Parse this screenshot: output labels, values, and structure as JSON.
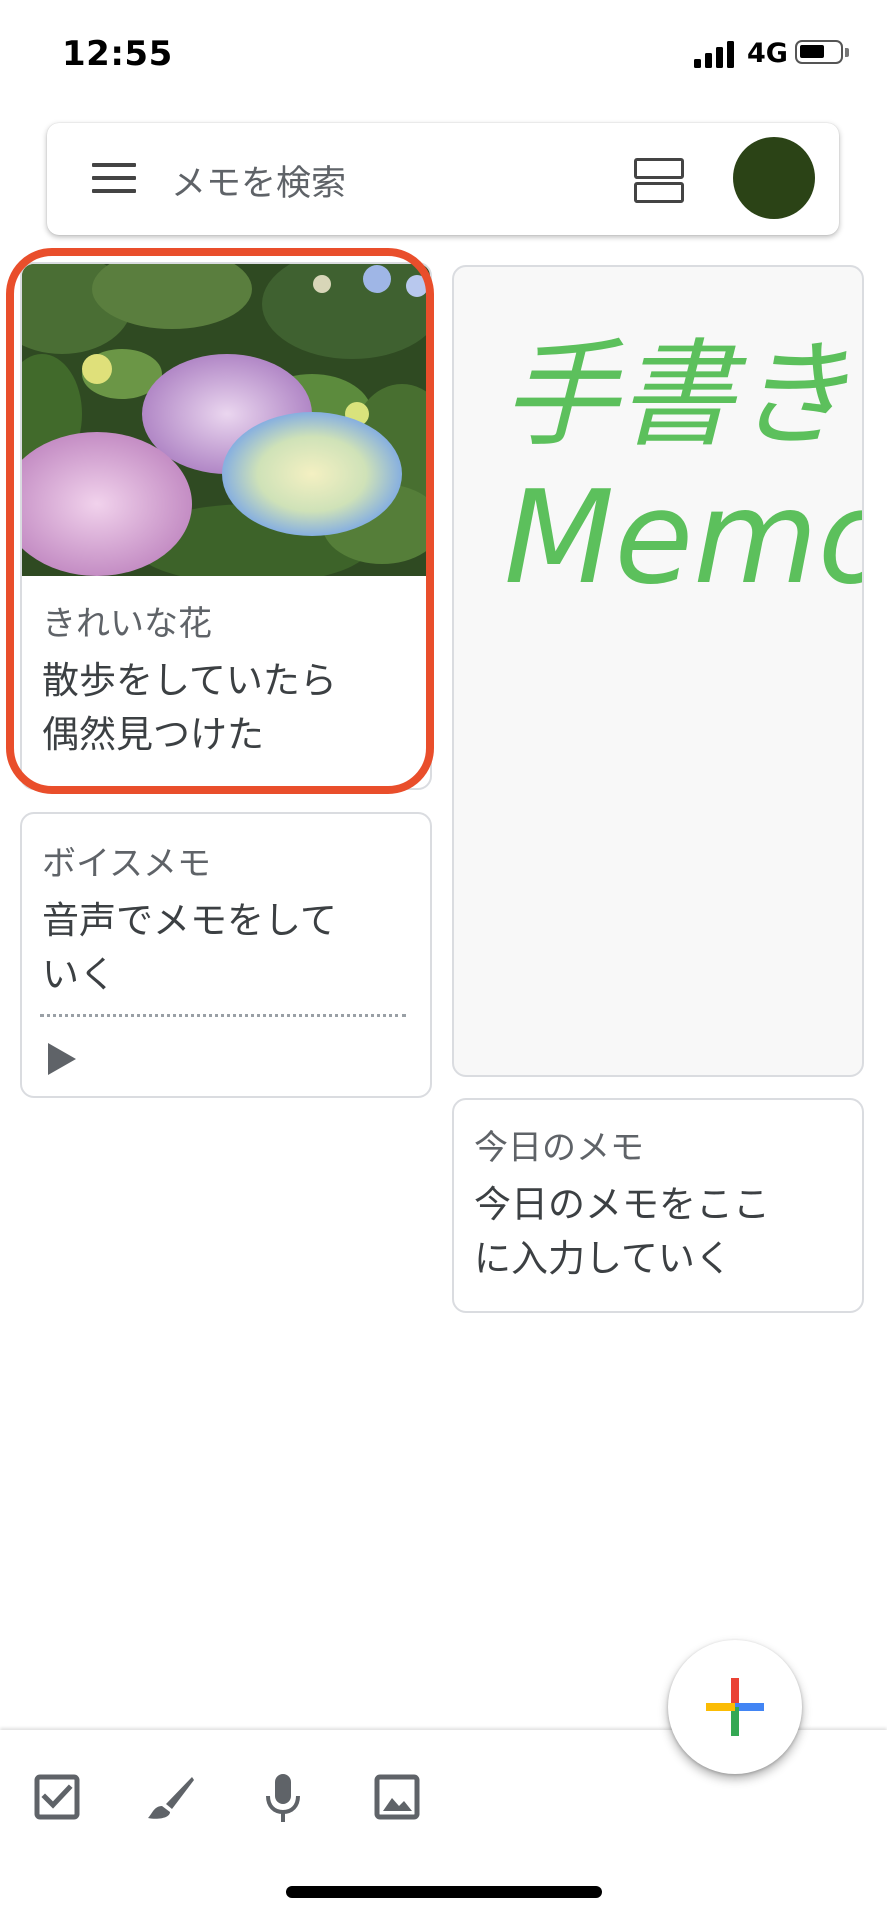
{
  "status_bar": {
    "time": "12:55",
    "network": "4G",
    "icons": [
      "cellular-signal-icon",
      "battery-icon"
    ]
  },
  "search_bar": {
    "placeholder": "メモを検索",
    "icons": [
      "menu-icon",
      "list-view-icon",
      "avatar"
    ]
  },
  "notes": [
    {
      "title": "きれいな花",
      "body": "散歩をしていたら\n偶然見つけた",
      "has_image": true,
      "highlighted": true
    },
    {
      "title": "ボイスメモ",
      "body": "音声でメモをして\nいく",
      "has_audio": true
    },
    {
      "handwriting": [
        "手書き",
        "Memo"
      ],
      "ink_color": "#5cc05c"
    },
    {
      "title": "今日のメモ",
      "body": "今日のメモをここ\nに入力していく"
    }
  ],
  "bottom_bar": {
    "icons": [
      "checkbox-icon",
      "brush-icon",
      "microphone-icon",
      "image-icon"
    ]
  },
  "fab": {
    "icon": "plus-icon"
  },
  "colors": {
    "highlight": "#e94e2b",
    "avatar": "#2b4316",
    "fab_red": "#ea4335",
    "fab_blue": "#4285f4",
    "fab_green": "#34a853",
    "fab_yellow": "#fbbc05"
  }
}
